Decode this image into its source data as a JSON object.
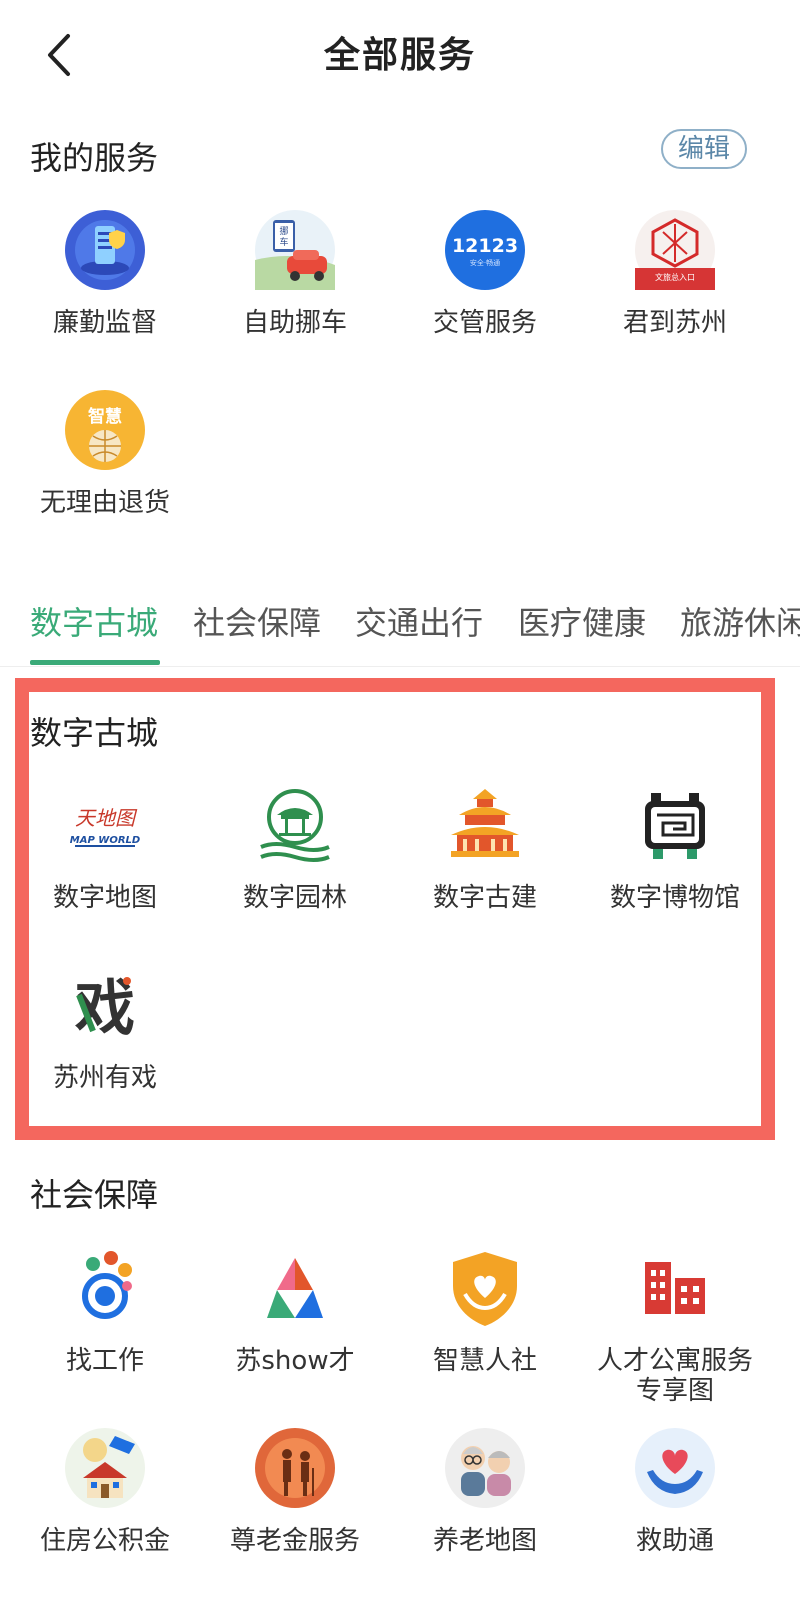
{
  "header": {
    "title": "全部服务"
  },
  "my_services": {
    "title": "我的服务",
    "edit_label": "编辑",
    "items": [
      {
        "label": "廉勤监督",
        "icon": "phone-shield-icon"
      },
      {
        "label": "自助挪车",
        "icon": "car-move-icon",
        "icon_text": "挪车"
      },
      {
        "label": "交管服务",
        "icon": "traffic-12123-icon",
        "icon_text": "12123",
        "icon_subtext": "安全·畅通"
      },
      {
        "label": "君到苏州",
        "icon": "culture-portal-icon",
        "icon_text": "文旅总入口"
      },
      {
        "label": "无理由退货",
        "icon": "smart-return-icon",
        "icon_text": "智慧"
      }
    ]
  },
  "tabs": [
    "数字古城",
    "社会保障",
    "交通出行",
    "医疗健康",
    "旅游休闲"
  ],
  "active_tab": "数字古城",
  "digital_city": {
    "title": "数字古城",
    "items": [
      {
        "label": "数字地图",
        "icon": "map-world-icon",
        "icon_text": "天地图",
        "icon_subtext": "MAP WORLD"
      },
      {
        "label": "数字园林",
        "icon": "garden-pavilion-icon"
      },
      {
        "label": "数字古建",
        "icon": "ancient-building-icon"
      },
      {
        "label": "数字博物馆",
        "icon": "museum-icon"
      },
      {
        "label": "苏州有戏",
        "icon": "opera-icon",
        "icon_text": "戏"
      }
    ]
  },
  "social_security": {
    "title": "社会保障",
    "items": [
      {
        "label": "找工作",
        "icon": "find-job-icon"
      },
      {
        "label": "苏show才",
        "icon": "talent-show-icon"
      },
      {
        "label": "智慧人社",
        "icon": "smart-social-icon"
      },
      {
        "label": "人才公寓服务",
        "label2": "专享图",
        "icon": "talent-apartment-icon"
      },
      {
        "label": "住房公积金",
        "icon": "housing-fund-icon"
      },
      {
        "label": "尊老金服务",
        "icon": "elderly-allowance-icon"
      },
      {
        "label": "养老地图",
        "icon": "elderly-map-icon"
      },
      {
        "label": "救助通",
        "icon": "assistance-icon"
      }
    ]
  },
  "colors": {
    "accent_green": "#3aaa78",
    "highlight_red": "#f4675e",
    "edit_blue": "#5b87a8"
  }
}
